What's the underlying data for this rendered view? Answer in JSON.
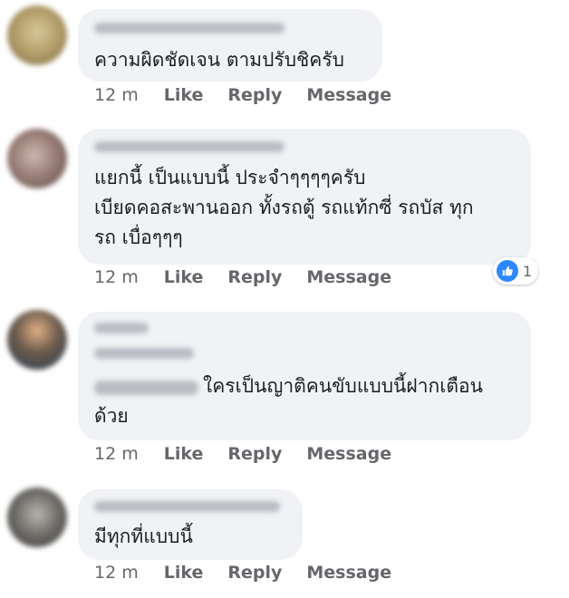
{
  "comments": [
    {
      "text": "ความผิดชัดเจน ตามปรับชิครับ",
      "time": "12 m",
      "like": "Like",
      "reply": "Reply",
      "message": "Message"
    },
    {
      "text": "แยกนี้ เป็นแบบนี้ ประจำๆๆๆๆครับ\nเบียดคอสะพานออก ทั้งรถตู้ รถแท้กซี่ รถบัส ทุก\nรถ เบื่อๆๆๆ",
      "time": "12 m",
      "like": "Like",
      "reply": "Reply",
      "message": "Message",
      "reaction": {
        "icon": "thumbs-up-icon",
        "count": "1"
      }
    },
    {
      "text": "ใครเป็นญาติคนขับแบบนี้ฝากเตือน\nด้วย",
      "time": "12 m",
      "like": "Like",
      "reply": "Reply",
      "message": "Message"
    },
    {
      "text": "มีทุกที่แบบนี้",
      "time": "12 m",
      "like": "Like",
      "reply": "Reply",
      "message": "Message"
    }
  ],
  "colors": {
    "bubble": "#f0f2f5",
    "meta": "#65676b",
    "like_blue": "#2d88ff"
  }
}
